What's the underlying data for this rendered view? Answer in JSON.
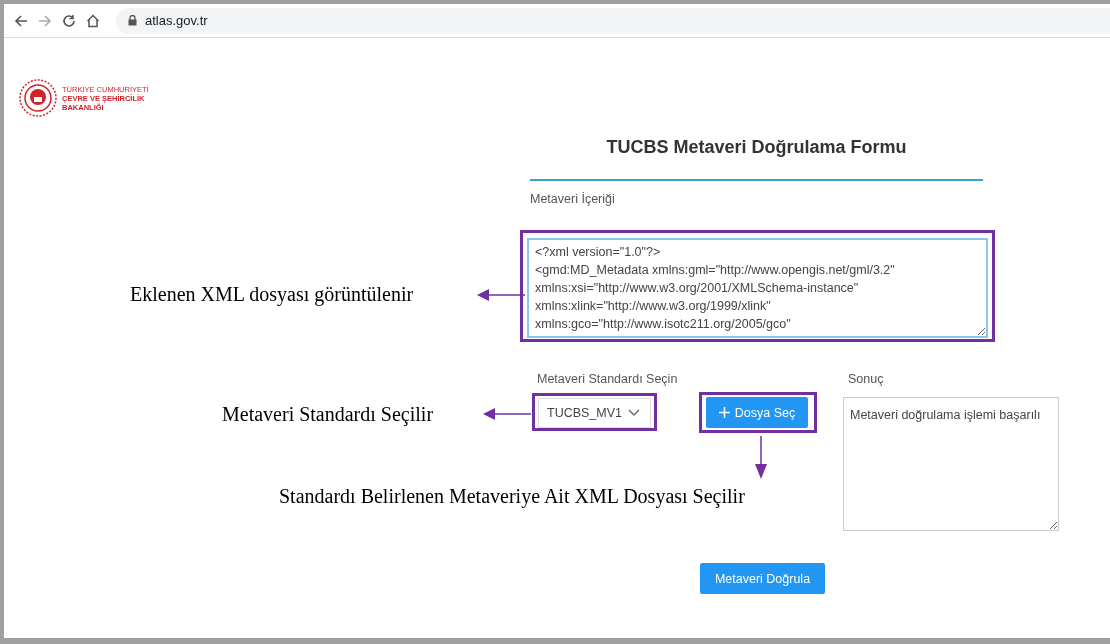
{
  "browser": {
    "url": "atlas.gov.tr"
  },
  "logo": {
    "lines": [
      "TÜRKİYE CUMHURİYETİ",
      "ÇEVRE VE ŞEHİRCİLİK",
      "BAKANLIĞI"
    ]
  },
  "form": {
    "title": "TUCBS Metaveri Doğrulama Formu",
    "content_label": "Metaveri İçeriği",
    "content_value": "<?xml version=\"1.0\"?>\n<gmd:MD_Metadata xmlns:gml=\"http://www.opengis.net/gml/3.2\"\nxmlns:xsi=\"http://www.w3.org/2001/XMLSchema-instance\"\nxmlns:xlink=\"http://www.w3.org/1999/xlink\"\nxmlns:gco=\"http://www.isotc211.org/2005/gco\"",
    "standard_label": "Metaveri Standardı Seçin",
    "standard_value": "TUCBS_MV1",
    "file_button": "Dosya Seç",
    "result_label": "Sonuç",
    "result_value": "Metaveri doğrulama işlemi başarılı",
    "validate_button": "Metaveri Doğrula"
  },
  "annotations": [
    {
      "text": "Eklenen XML dosyası görüntülenir"
    },
    {
      "text": "Metaveri Standardı Seçilir"
    },
    {
      "text": "Standardı Belirlenen Metaveriye Ait XML Dosyası Seçilir"
    }
  ]
}
